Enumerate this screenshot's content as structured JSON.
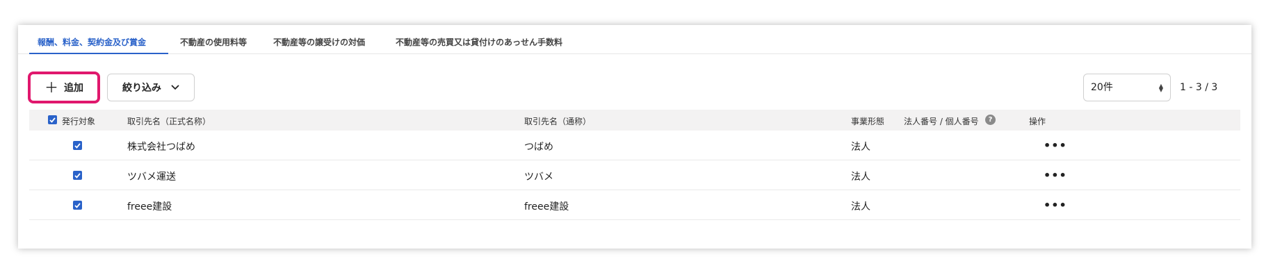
{
  "tabs": [
    {
      "label": "報酬、料金、契約金及び賞金",
      "active": true
    },
    {
      "label": "不動産の使用料等",
      "active": false
    },
    {
      "label": "不動産等の譲受けの対価",
      "active": false
    },
    {
      "label": "不動産等の売買又は貸付けのあっせん手数料",
      "active": false
    }
  ],
  "toolbar": {
    "add_label": "追加",
    "filter_label": "絞り込み",
    "per_page": "20件",
    "pagination": "1 - 3 / 3"
  },
  "table": {
    "headers": {
      "issue_target": "発行対象",
      "official_name": "取引先名（正式名称）",
      "common_name": "取引先名（通称）",
      "business_type": "事業形態",
      "corporate_number": "法人番号 / 個人番号",
      "actions": "操作"
    },
    "rows": [
      {
        "checked": true,
        "official_name": "株式会社つばめ",
        "common_name": "つばめ",
        "business_type": "法人",
        "actions": "•••"
      },
      {
        "checked": true,
        "official_name": "ツバメ運送",
        "common_name": "ツバメ",
        "business_type": "法人",
        "actions": "•••"
      },
      {
        "checked": true,
        "official_name": "freee建設",
        "common_name": "freee建設",
        "business_type": "法人",
        "actions": "•••"
      }
    ]
  },
  "colors": {
    "accent": "#2a62c9",
    "highlight": "#e0186d"
  },
  "icons": {
    "add": "plus-icon",
    "filter": "chevron-down-icon",
    "help": "question-circle-icon",
    "more": "more-horizontal-icon",
    "checkbox": "checkbox-checked-icon"
  }
}
